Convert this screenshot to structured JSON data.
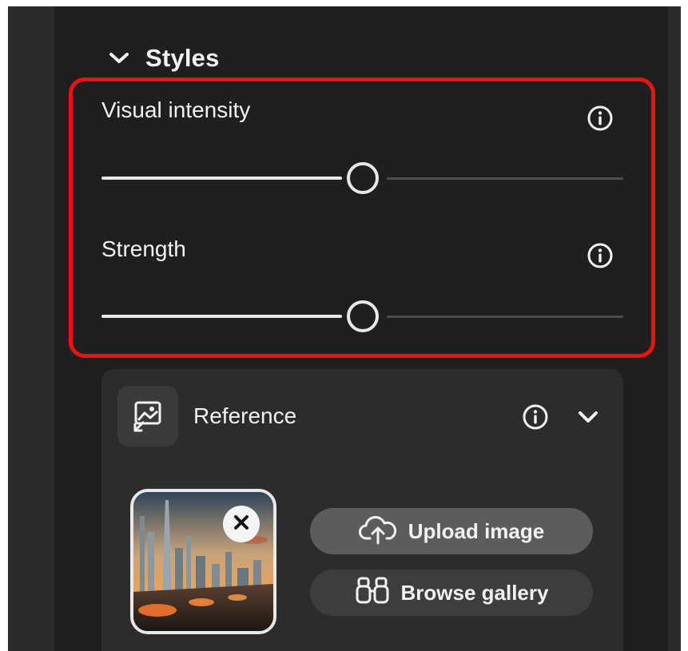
{
  "section": {
    "title": "Styles",
    "expand_icon": "chevron-down-icon"
  },
  "highlight_color": "#ee1111",
  "sliders": [
    {
      "label": "Visual intensity",
      "value_fraction": 0.5,
      "info_icon": "info-icon"
    },
    {
      "label": "Strength",
      "value_fraction": 0.5,
      "info_icon": "info-icon"
    }
  ],
  "reference": {
    "title": "Reference",
    "icon": "reference-image-icon",
    "info_icon": "info-icon",
    "expand_icon": "chevron-down-icon",
    "thumbnail_remove_icon": "close-icon",
    "upload_label": "Upload image",
    "upload_icon": "cloud-upload-icon",
    "browse_label": "Browse gallery",
    "browse_icon": "binoculars-icon"
  },
  "colors": {
    "panel_bg": "#1f1f1f",
    "text": "#f2f2f2",
    "track_active": "#e8e8e8",
    "track_inactive": "#4d4d4d"
  }
}
